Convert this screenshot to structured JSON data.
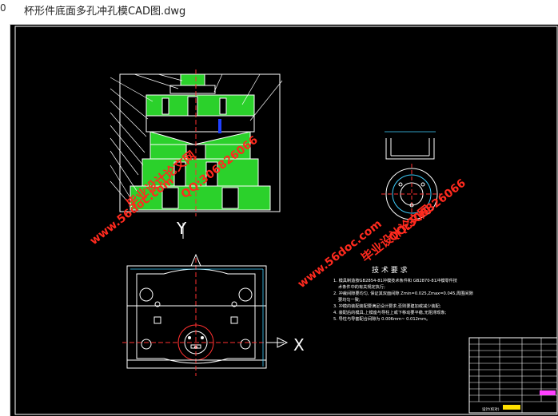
{
  "window": {
    "app_icon": "0",
    "title": "杯形件底面多孔冲孔模CAD图.dwg"
  },
  "drawing": {
    "view_label_y": "Y",
    "view_label_x": "X",
    "tech_requirements": {
      "heading": "技 术 要 求",
      "lines": [
        "1. 模具制造按GB2854-81冲模技术条件和 GB2870-81冲模零件技",
        "术条件中的有关规定执行;",
        "2. 冲裁间隙要均匀, 保证其双面间隙 Zmin=0.025,Zmax=0.045,周围间隙",
        "要均匀一致;",
        "3. 冲模的装配装配要满足设计要求,否则要建加或减少装配;",
        "4. 装配后的模具,上模座与导柱上或下移动要平稳,无阻滞现象;",
        "5. 导柱与导套配合间隙为 0.006mm~ 0.012mm。"
      ]
    },
    "title_block": {
      "project_label": "设计(校对)"
    }
  },
  "watermarks": {
    "site_left": "www.56doc.com",
    "qq_left": "QQ:306826066",
    "label_left": "毕业设计论文网",
    "site_right": "www.56doc.com",
    "qq_right": "QQ:306826066",
    "label_right": "毕业设计论文网"
  },
  "colors": {
    "background": "#000000",
    "line_white": "#ffffff",
    "hatch_green": "#2bd12b",
    "dim_cyan": "#3fd0ff",
    "red_center": "#ff3030",
    "watermark_red": "#ff2a1e",
    "title_yellow": "#ffe000",
    "title_magenta": "#ff40ff"
  }
}
